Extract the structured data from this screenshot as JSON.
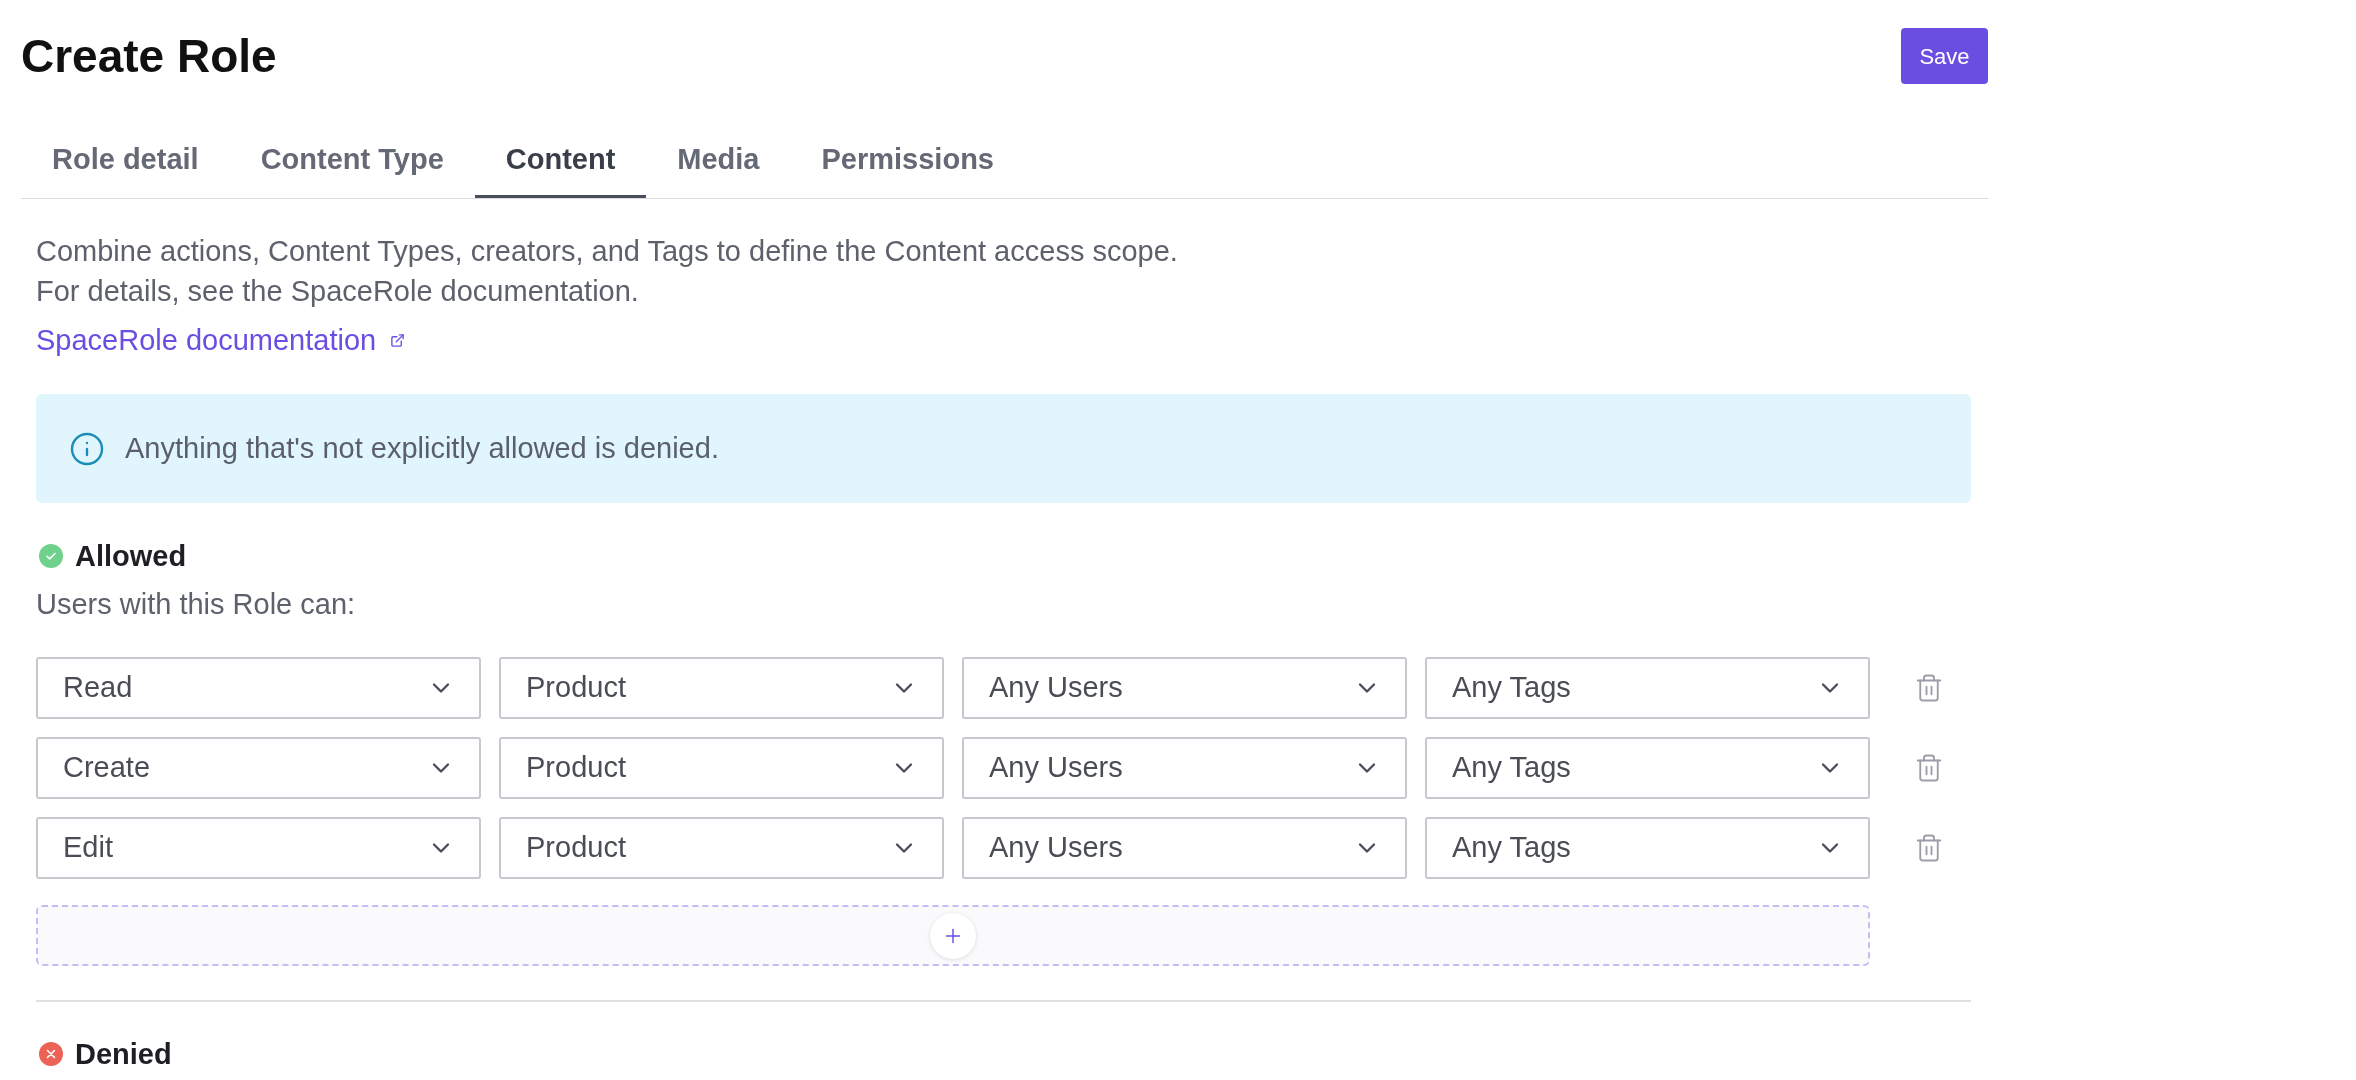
{
  "page": {
    "title": "Create Role",
    "save_button": "Save"
  },
  "tabs": [
    {
      "label": "Role detail",
      "selected": false
    },
    {
      "label": "Content Type",
      "selected": false
    },
    {
      "label": "Content",
      "selected": true
    },
    {
      "label": "Media",
      "selected": false
    },
    {
      "label": "Permissions",
      "selected": false
    }
  ],
  "intro": {
    "lines": [
      "Combine actions, Content Types, creators, and Tags to define the Content access scope.",
      "For details, see the SpaceRole documentation."
    ],
    "link": "SpaceRole documentation"
  },
  "alert": {
    "text": "Anything that's not explicitly allowed is denied."
  },
  "sections": [
    {
      "kind": "allowed",
      "title": "Allowed",
      "subtitle": "Users with this Role can:",
      "rules": [
        {
          "action": "Read",
          "content_type": "Product",
          "creator": "Any Users",
          "tag": "Any Tags"
        },
        {
          "action": "Create",
          "content_type": "Product",
          "creator": "Any Users",
          "tag": "Any Tags"
        },
        {
          "action": "Edit",
          "content_type": "Product",
          "creator": "Any Users",
          "tag": "Any Tags"
        }
      ]
    },
    {
      "kind": "denied",
      "title": "Denied"
    }
  ]
}
